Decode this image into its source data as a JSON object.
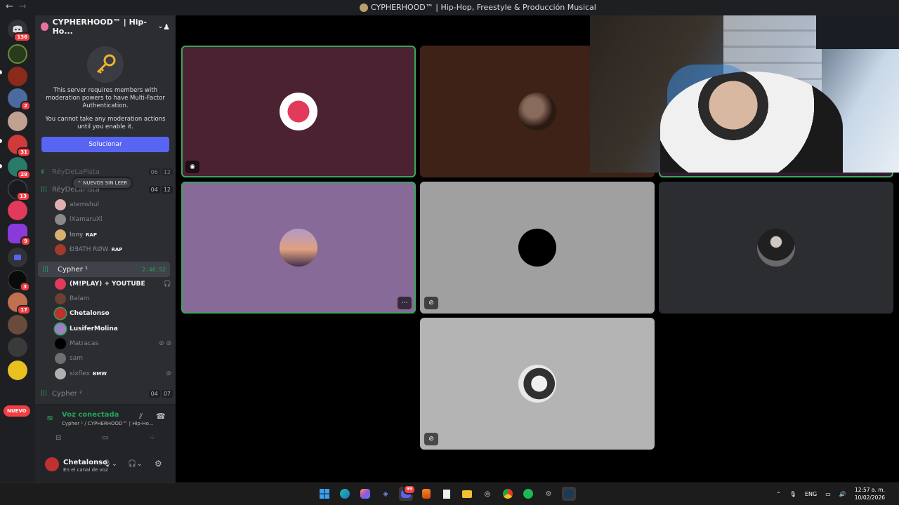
{
  "window": {
    "title": "CYPHERHOOD™ | Hip-Hop, Freestyle & Producción Musical",
    "back_arrow": "←",
    "forward_arrow": "→"
  },
  "guild_badges": {
    "discord": "136",
    "g3": "2",
    "g6": "31",
    "g7": "29",
    "g8": "13",
    "g10": "9",
    "g12": "3",
    "g13": "17"
  },
  "nuevo_label": "NUEVO",
  "server": {
    "name": "CYPHERHOOD™ | Hip-Ho...",
    "chevron": "⌄",
    "add_member_icon": "♟"
  },
  "mfa": {
    "line1": "This server requires members with moderation powers to have Multi-Factor Authentication.",
    "line2": "You cannot take any moderation actions until you enable it.",
    "button": "Solucionar"
  },
  "channels": {
    "reydelapista_top": {
      "name": "RéyDeLaPista",
      "count_a": "06",
      "count_b": "12"
    },
    "new_unread": "⌃ NUEVOS SIN LEER",
    "reydelapista": {
      "name": "RéyDeLaPista",
      "count_a": "04",
      "count_b": "12"
    },
    "cypher1": {
      "name": "Cypher ¹",
      "time": "2:46:52"
    },
    "cypher2": {
      "name": "Cypher ²",
      "count_a": "04",
      "count_b": "07"
    }
  },
  "members_rey": [
    {
      "name": "atemshul",
      "tag": ""
    },
    {
      "name": "lXamaruXl",
      "tag": ""
    },
    {
      "name": "𝐭𝐨𝐧𝐲",
      "tag": "RAP"
    },
    {
      "name": "ÐƎATH RØW",
      "tag": "RAP"
    }
  ],
  "members_cypher1": [
    {
      "name": "(M!PLAY) + YOUTUBE",
      "tag": ""
    },
    {
      "name": "Balam",
      "tag": ""
    },
    {
      "name": "Chetalonso",
      "tag": ""
    },
    {
      "name": "LusiferMolina",
      "tag": ""
    },
    {
      "name": "Matracas",
      "tag": ""
    },
    {
      "name": "sam",
      "tag": ""
    },
    {
      "name": "sixflex",
      "tag": "BMW"
    }
  ],
  "voice": {
    "status": "Voz conectada",
    "location": "Cypher ¹ / CYPHERHOOD™ | Hip-Ho..."
  },
  "user": {
    "name": "Chetalonso",
    "status": "En el canal de voz"
  },
  "taskbar": {
    "discord_badge": "99",
    "lang": "ENG",
    "time": "12:57 a. m.",
    "date": "10/02/2026"
  },
  "colors": {
    "accent": "#5865f2",
    "speaking": "#3ba55d",
    "badge": "#f23f43"
  }
}
